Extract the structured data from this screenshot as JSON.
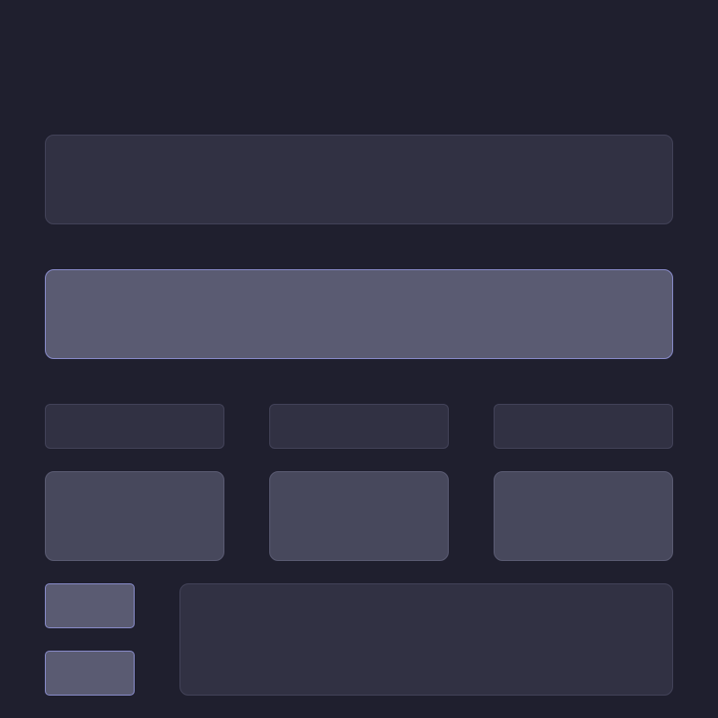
{
  "theme": {
    "background": "#1f1f2e",
    "dark_surface": "#313143",
    "mid_surface": "#47485c",
    "light_surface": "#5a5b72",
    "accent_border": "#8c8fd0"
  },
  "header": {
    "label": ""
  },
  "highlight": {
    "label": ""
  },
  "small_cards": [
    {
      "label": ""
    },
    {
      "label": ""
    },
    {
      "label": ""
    }
  ],
  "tiles": [
    {
      "label": ""
    },
    {
      "label": ""
    },
    {
      "label": ""
    }
  ],
  "side_buttons": [
    {
      "label": ""
    },
    {
      "label": ""
    }
  ],
  "content_panel": {
    "label": ""
  }
}
